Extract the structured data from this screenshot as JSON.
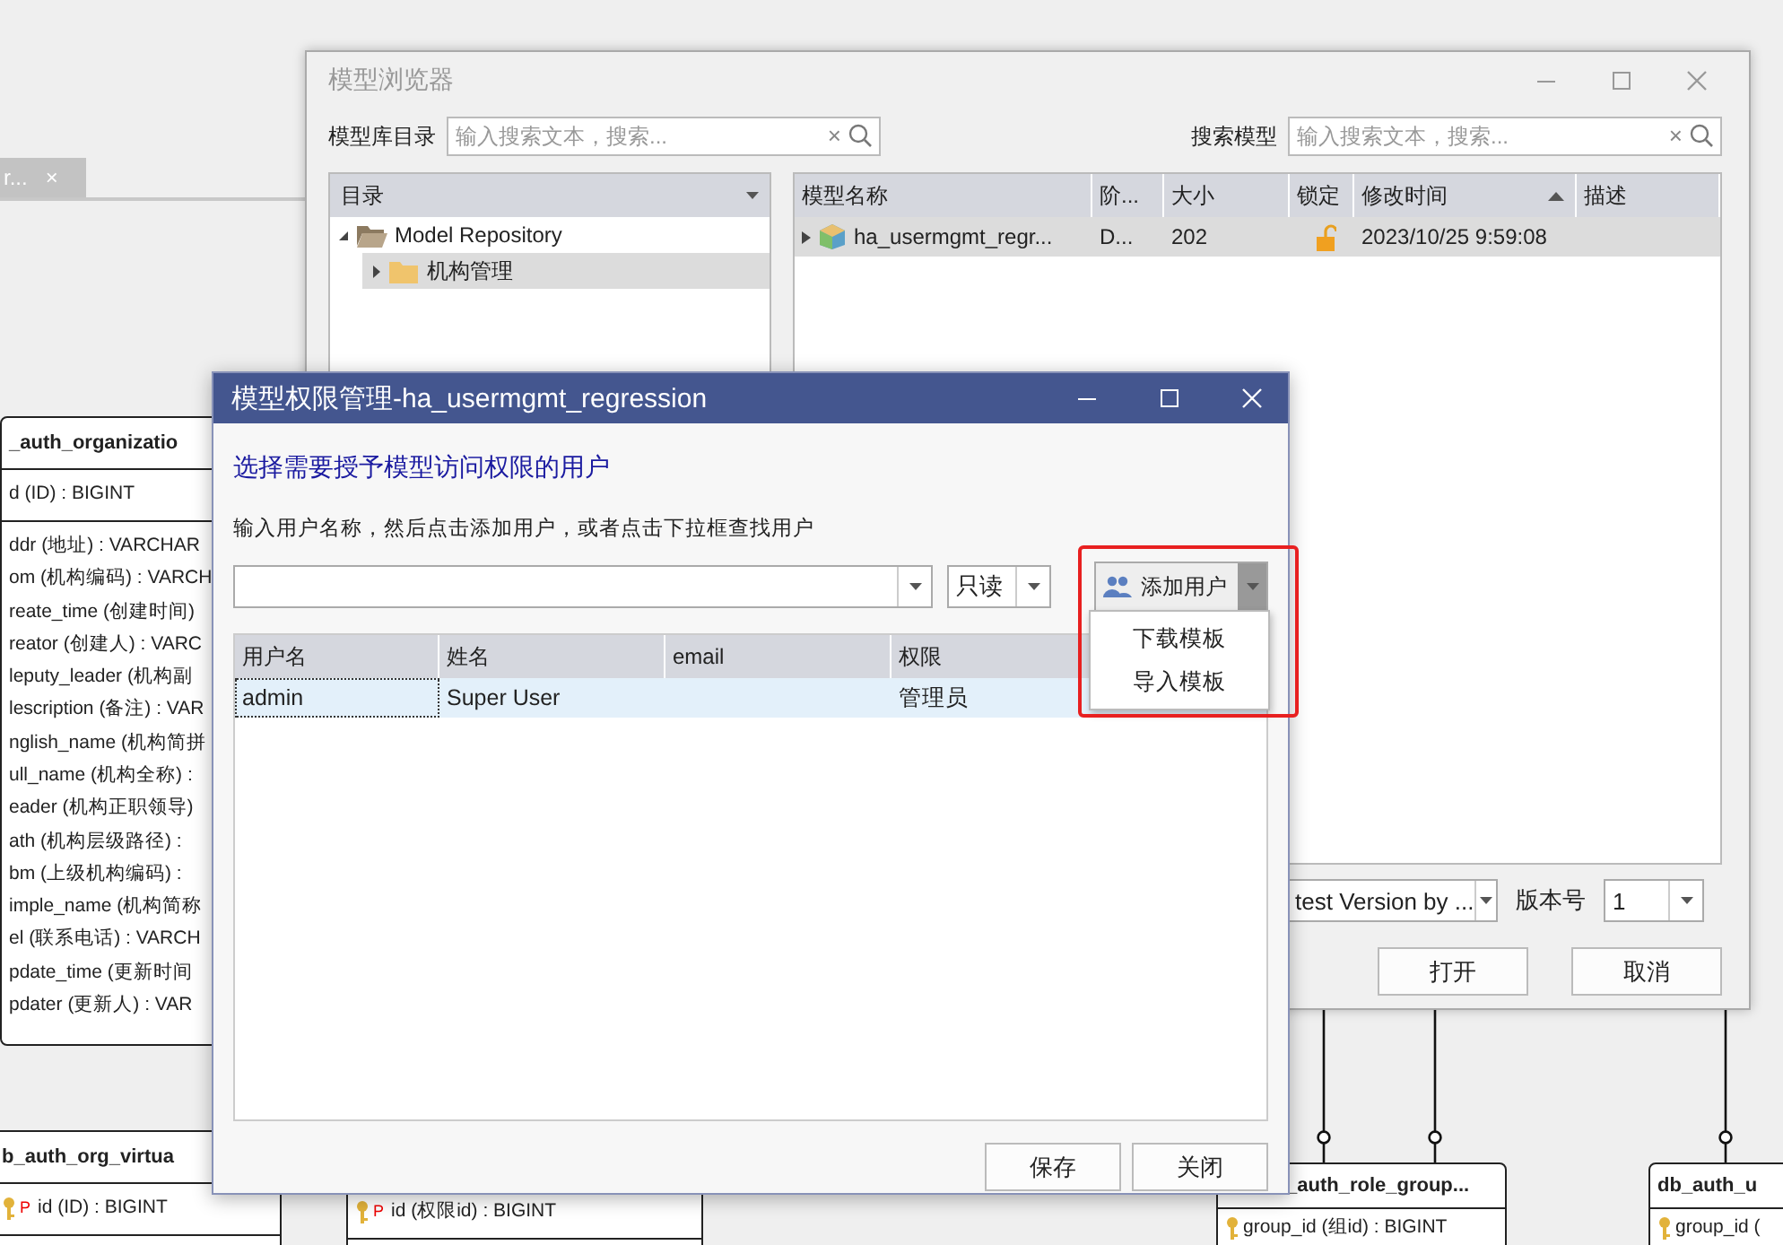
{
  "canvas_tab": {
    "label": "r...",
    "close": "×"
  },
  "entities": [
    {
      "title": "_auth_organizatio",
      "key_fields": [
        {
          "text": "d (ID) : BIGINT",
          "kind": "plain"
        }
      ],
      "fields": [
        "ddr (地址) : VARCHAR",
        "om (机构编码) : VARCH",
        "reate_time (创建时间)",
        "reator (创建人) : VARC",
        "leputy_leader (机构副",
        "lescription (备注) : VAR",
        "nglish_name (机构简拼",
        "ull_name (机构全称) :",
        "eader (机构正职领导)",
        "ath (机构层级路径) :",
        "bm (上级机构编码) :",
        "imple_name (机构简称",
        "el (联系电话) : VARCH",
        "pdate_time (更新时间",
        "pdater (更新人) : VAR"
      ]
    },
    {
      "title": "b_auth_org_virtua",
      "key_fields": [
        {
          "text": "id (ID) : BIGINT",
          "kind": "key",
          "badge": "P"
        }
      ]
    },
    {
      "key_fields": [
        {
          "text": "id (权限id) : BIGINT",
          "kind": "key",
          "badge": "P"
        }
      ]
    },
    {
      "title": "_auth_role_group...",
      "key_fields": [
        {
          "text": "group_id (组id) : BIGINT",
          "kind": "key"
        }
      ]
    },
    {
      "title": "db_auth_u",
      "key_fields": [
        {
          "text": "group_id (",
          "kind": "key"
        }
      ]
    }
  ],
  "model_browser": {
    "title": "模型浏览器",
    "repo_search": {
      "label": "模型库目录",
      "placeholder": "输入搜索文本，搜索...",
      "clear": "×"
    },
    "model_search": {
      "label": "搜索模型",
      "placeholder": "输入搜索文本，搜索...",
      "clear": "×"
    },
    "tree": {
      "header": "目录",
      "items": [
        {
          "label": "Model Repository",
          "expanded": true,
          "selected": false,
          "children": [
            {
              "label": "机构管理",
              "expanded": false,
              "selected": true
            }
          ]
        }
      ]
    },
    "columns": [
      {
        "label": "模型名称",
        "sorted": false
      },
      {
        "label": "阶...",
        "sorted": false
      },
      {
        "label": "大小",
        "sorted": false
      },
      {
        "label": "锁定",
        "sorted": false
      },
      {
        "label": "修改时间",
        "sorted": true
      },
      {
        "label": "描述",
        "sorted": false
      }
    ],
    "rows": [
      {
        "name": "ha_usermgmt_regr...",
        "stage": "D...",
        "size": "202",
        "locked": false,
        "modified": "2023/10/25 9:59:08",
        "selected": true
      }
    ],
    "version_select": {
      "value": "test Version by ..."
    },
    "version_number": {
      "label": "版本号",
      "value": "1"
    },
    "buttons": [
      "打开",
      "取消"
    ]
  },
  "permission_dialog": {
    "title": "模型权限管理-ha_usermgmt_regression",
    "heading": "选择需要授予模型访问权限的用户",
    "hint": "输入用户名称，然后点击添加用户，或者点击下拉框查找用户",
    "permission_select": {
      "value": "只读"
    },
    "add_button": {
      "label": "添加用户",
      "menu_open": true
    },
    "menu": [
      "下载模板",
      "导入模板"
    ],
    "columns": [
      "用户名",
      "姓名",
      "email",
      "权限"
    ],
    "rows": [
      {
        "username": "admin",
        "name": "Super User",
        "permission": "管理员",
        "selected": true
      }
    ],
    "buttons": [
      "保存",
      "关闭"
    ]
  }
}
